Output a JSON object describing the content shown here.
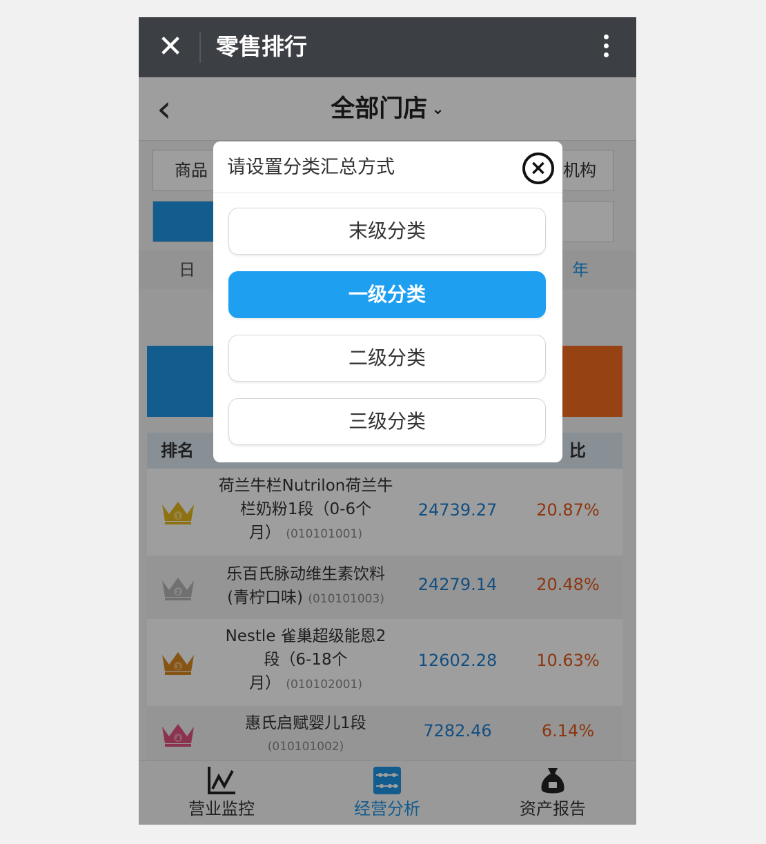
{
  "appbar": {
    "title": "零售排行"
  },
  "header": {
    "store": "全部门店"
  },
  "dimensions": {
    "product": "商品",
    "org": "机构"
  },
  "periods": {
    "day": "日",
    "year": "年"
  },
  "table": {
    "col_rank": "排名",
    "col_ratio_partial": "比"
  },
  "rows": [
    {
      "rank": "1",
      "name": "荷兰牛栏Nutrilon荷兰牛栏奶粉1段（0-6个月）",
      "line1": "荷兰牛栏Nutrilon荷兰牛",
      "line2": "栏奶粉1段（0-6个",
      "line3": "月）",
      "code": "(010101001)",
      "amount": "24739.27",
      "ratio": "20.87%",
      "crown_color": "#e6b91e"
    },
    {
      "rank": "2",
      "line1": "乐百氏脉动维生素饮料",
      "line2": "(青柠口味)",
      "code": "(010101003)",
      "amount": "24279.14",
      "ratio": "20.48%",
      "crown_color": "#b5b5b5"
    },
    {
      "rank": "3",
      "line1": "Nestle 雀巢超级能恩2",
      "line2": "段（6-18个",
      "line3": "月）",
      "code": "(010102001)",
      "amount": "12602.28",
      "ratio": "10.63%",
      "crown_color": "#d98a22"
    },
    {
      "rank": "4",
      "line1": "惠氏启赋婴儿1段",
      "code": "(010101002)",
      "amount": "7282.46",
      "ratio": "6.14%",
      "crown_color": "#e0517f"
    }
  ],
  "tabs": [
    {
      "label": "营业监控",
      "icon": "line-chart-icon"
    },
    {
      "label": "经营分析",
      "icon": "abacus-icon"
    },
    {
      "label": "资产报告",
      "icon": "money-bag-icon"
    }
  ],
  "dialog": {
    "title": "请设置分类汇总方式",
    "options": [
      "末级分类",
      "一级分类",
      "二级分类",
      "三级分类"
    ],
    "selected": "一级分类"
  },
  "colors": {
    "accent": "#1f95e6",
    "orange": "#f26b1d",
    "amount": "#1f7fd0",
    "ratio": "#e2581b"
  }
}
